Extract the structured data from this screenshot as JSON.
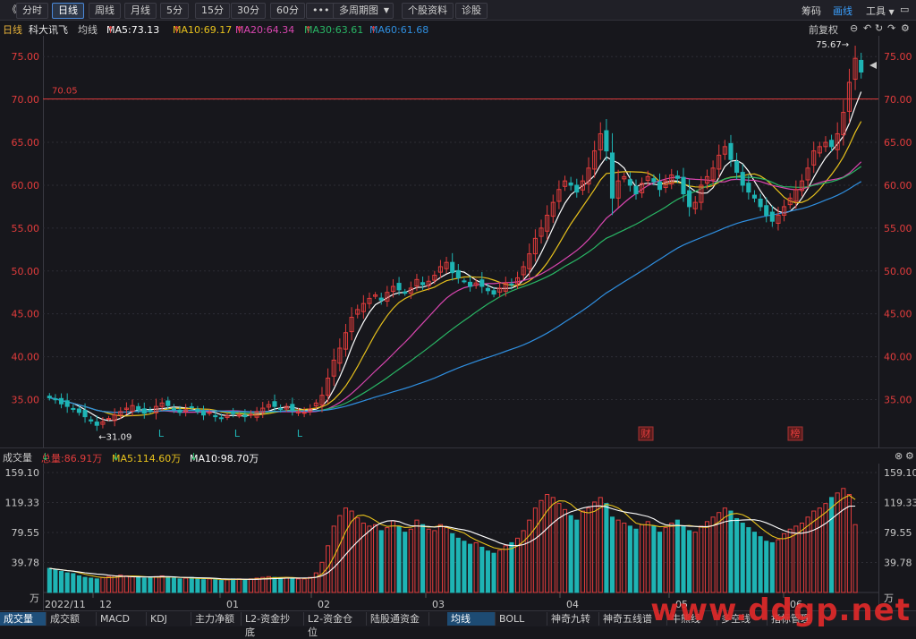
{
  "toolbar": {
    "back": "《",
    "periods": [
      "分时",
      "日线",
      "周线",
      "月线",
      "5分",
      "15分",
      "30分",
      "60分"
    ],
    "active_period": "日线",
    "more": "•••",
    "multi_period": "多周期图",
    "stock_info": "个股资料",
    "diagnose": "诊股",
    "right_items": [
      "筹码",
      "画线",
      "工具"
    ]
  },
  "legend": {
    "period": "日线",
    "stock": "科大讯飞",
    "ma_label": "均线",
    "ma5": "MA5:73.13",
    "ma10": "MA10:69.17",
    "ma20": "MA20:64.34",
    "ma30": "MA30:63.61",
    "ma60": "MA60:61.68",
    "restore": "前复权"
  },
  "volume_legend": {
    "title": "成交量",
    "total": "总量:86.91万",
    "ma5": "MA5:114.60万",
    "ma10": "MA10:98.70万"
  },
  "annotations": {
    "hline": "70.05",
    "high": "75.67",
    "low": "31.09",
    "markers": [
      "L",
      "L",
      "L",
      "财",
      "榜"
    ]
  },
  "bottom_tabs": [
    "成交量",
    "成交额",
    "MACD",
    "KDJ",
    "主力净额",
    "L2-资金抄底",
    "L2-资金仓位",
    "陆股通资金",
    "均线",
    "BOLL",
    "神奇九转",
    "神奇五线谱",
    "牛熊线",
    "多空线",
    "指标管理"
  ],
  "watermark": "www.ddgp.net",
  "colors": {
    "up": "#e23c3c",
    "down": "#1eb4b4",
    "ma5": "#ffffff",
    "ma10": "#e8c21c",
    "ma20": "#d946b0",
    "ma30": "#29b765",
    "ma60": "#2f8fe0"
  },
  "chart_data": [
    {
      "type": "candlestick",
      "y_ticks": [
        "75.00",
        "70.00",
        "65.00",
        "60.00",
        "55.00",
        "50.00",
        "45.00",
        "40.00",
        "35.00"
      ],
      "ylim": [
        31.5,
        76.8
      ],
      "x_labels": [
        "2022/11",
        "12",
        "01",
        "02",
        "03",
        "04",
        "05",
        "06"
      ],
      "hline": 70.05,
      "close": [
        35.2,
        35.0,
        34.5,
        34.2,
        33.9,
        33.5,
        33.0,
        32.5,
        32.0,
        32.4,
        32.8,
        33.2,
        33.6,
        34.0,
        34.3,
        33.8,
        33.4,
        33.7,
        34.2,
        34.6,
        34.3,
        33.9,
        33.5,
        33.8,
        34.1,
        33.6,
        33.2,
        33.5,
        33.0,
        32.8,
        33.1,
        33.4,
        33.2,
        33.0,
        33.3,
        33.6,
        34.0,
        34.4,
        34.2,
        33.9,
        34.2,
        33.8,
        33.6,
        33.5,
        33.9,
        34.6,
        35.5,
        37.5,
        39.6,
        41.0,
        42.8,
        44.6,
        45.5,
        46.2,
        46.8,
        47.2,
        46.6,
        47.5,
        48.2,
        47.8,
        47.4,
        48.0,
        49.0,
        48.4,
        48.8,
        49.5,
        50.5,
        51.0,
        49.8,
        49.2,
        48.8,
        48.2,
        48.6,
        48.2,
        47.7,
        47.3,
        48.0,
        48.6,
        48.4,
        49.2,
        50.5,
        52.0,
        53.8,
        55.0,
        56.5,
        58.0,
        59.5,
        60.5,
        60.0,
        59.2,
        60.5,
        62.0,
        64.0,
        66.0,
        64.0,
        58.5,
        60.5,
        61.0,
        60.0,
        59.0,
        60.2,
        61.0,
        60.4,
        59.5,
        60.5,
        61.2,
        60.8,
        59.0,
        57.5,
        58.0,
        60.0,
        61.0,
        62.0,
        63.5,
        64.5,
        63.0,
        61.5,
        60.0,
        59.2,
        58.5,
        57.5,
        56.5,
        55.8,
        56.5,
        57.5,
        58.5,
        59.5,
        60.5,
        62.0,
        64.0,
        64.5,
        65.0,
        64.5,
        66.0,
        68.5,
        72.0,
        74.8,
        73.2
      ],
      "volume": [
        32,
        30,
        28,
        26,
        25,
        22,
        20,
        19,
        18,
        20,
        21,
        22,
        23,
        22,
        21,
        20,
        19,
        20,
        21,
        22,
        20,
        19,
        18,
        19,
        20,
        18,
        17,
        18,
        17,
        16,
        17,
        18,
        18,
        17,
        18,
        19,
        20,
        21,
        20,
        19,
        20,
        19,
        18,
        18,
        20,
        26,
        40,
        62,
        88,
        102,
        112,
        108,
        99,
        92,
        88,
        90,
        82,
        86,
        95,
        88,
        80,
        84,
        96,
        90,
        84,
        82,
        90,
        86,
        78,
        72,
        68,
        64,
        66,
        60,
        55,
        52,
        56,
        62,
        66,
        72,
        82,
        96,
        112,
        122,
        130,
        126,
        118,
        110,
        102,
        96,
        108,
        112,
        120,
        126,
        118,
        100,
        96,
        92,
        88,
        84,
        90,
        94,
        88,
        80,
        86,
        92,
        96,
        88,
        82,
        80,
        88,
        94,
        100,
        106,
        112,
        108,
        98,
        92,
        86,
        80,
        74,
        68,
        66,
        70,
        78,
        84,
        88,
        92,
        100,
        108,
        112,
        118,
        126,
        132,
        138,
        130,
        90
      ],
      "volume_axis": [
        "159.10",
        "119.33",
        "79.55",
        "39.78",
        "万"
      ]
    }
  ]
}
